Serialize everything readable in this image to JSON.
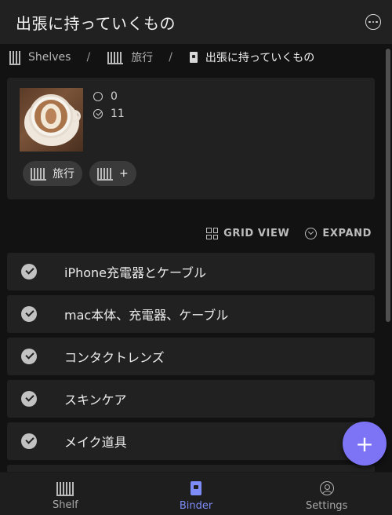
{
  "app": {
    "title": "出張に持っていくもの"
  },
  "breadcrumb": {
    "items": [
      {
        "label": "Shelves",
        "icon": "shelf-icon"
      },
      {
        "label": "旅行",
        "icon": "shelf-icon"
      },
      {
        "label": "出張に持っていくもの",
        "icon": "notebook-icon"
      }
    ],
    "separator": "/"
  },
  "summary": {
    "unchecked_count": "0",
    "checked_count": "11",
    "chips": [
      {
        "label": "旅行",
        "icon": "shelf-icon"
      },
      {
        "label": "+",
        "icon": "shelf-icon"
      }
    ]
  },
  "view_controls": {
    "grid_label": "GRID VIEW",
    "expand_label": "EXPAND"
  },
  "items": [
    {
      "label": "iPhone充電器とケーブル",
      "checked": true
    },
    {
      "label": "mac本体、充電器、ケーブル",
      "checked": true
    },
    {
      "label": "コンタクトレンズ",
      "checked": true
    },
    {
      "label": "スキンケア",
      "checked": true
    },
    {
      "label": "メイク道具",
      "checked": true
    }
  ],
  "fab": {
    "label": "+"
  },
  "bottom_nav": [
    {
      "label": "Shelf",
      "icon": "shelf-icon",
      "active": false
    },
    {
      "label": "Binder",
      "icon": "binder-icon",
      "active": true
    },
    {
      "label": "Settings",
      "icon": "account-circle-icon",
      "active": false
    }
  ],
  "colors": {
    "accent": "#7c74f5",
    "active_nav": "#7e8cf7",
    "card": "#212121",
    "background": "#121212"
  }
}
